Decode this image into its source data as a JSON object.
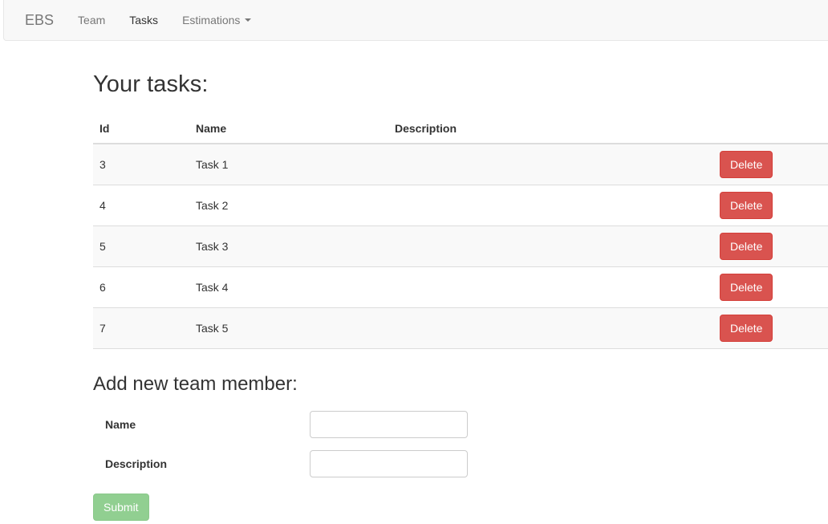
{
  "navbar": {
    "brand": "EBS",
    "items": [
      {
        "label": "Team",
        "active": false,
        "dropdown": false
      },
      {
        "label": "Tasks",
        "active": true,
        "dropdown": false
      },
      {
        "label": "Estimations",
        "active": false,
        "dropdown": true
      }
    ]
  },
  "main": {
    "tasks_heading": "Your tasks:",
    "table": {
      "columns": [
        "Id",
        "Name",
        "Description",
        ""
      ],
      "rows": [
        {
          "id": "3",
          "name": "Task 1",
          "description": "",
          "action": "Delete"
        },
        {
          "id": "4",
          "name": "Task 2",
          "description": "",
          "action": "Delete"
        },
        {
          "id": "5",
          "name": "Task 3",
          "description": "",
          "action": "Delete"
        },
        {
          "id": "6",
          "name": "Task 4",
          "description": "",
          "action": "Delete"
        },
        {
          "id": "7",
          "name": "Task 5",
          "description": "",
          "action": "Delete"
        }
      ]
    },
    "form": {
      "heading": "Add new team member:",
      "fields": [
        {
          "label": "Name",
          "value": "",
          "placeholder": ""
        },
        {
          "label": "Description",
          "value": "",
          "placeholder": ""
        }
      ],
      "submit_label": "Submit"
    }
  },
  "colors": {
    "navbar_bg": "#f8f8f8",
    "navbar_border": "#e7e7e7",
    "link": "#777777",
    "link_active": "#333333",
    "danger": "#d9534f",
    "success_muted": "#91cf91",
    "table_stripe": "#f9f9f9",
    "table_border": "#dddddd",
    "input_border": "#cccccc"
  }
}
